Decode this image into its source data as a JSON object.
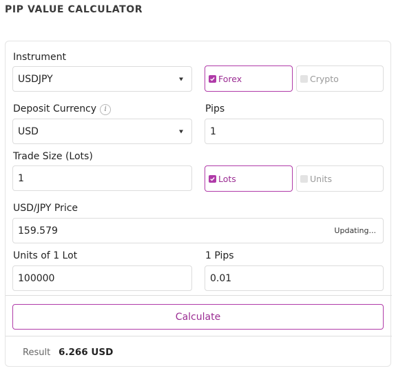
{
  "title": "PIP VALUE CALCULATOR",
  "instrument": {
    "label": "Instrument",
    "value": "USDJPY"
  },
  "market_type": {
    "forex_label": "Forex",
    "crypto_label": "Crypto",
    "selected": "Forex"
  },
  "deposit_currency": {
    "label": "Deposit Currency",
    "value": "USD",
    "info_icon": "i"
  },
  "pips": {
    "label": "Pips",
    "value": "1"
  },
  "trade_size": {
    "label": "Trade Size (Lots)",
    "value": "1"
  },
  "size_type": {
    "lots_label": "Lots",
    "units_label": "Units",
    "selected": "Lots"
  },
  "price": {
    "label": "USD/JPY Price",
    "value": "159.579",
    "status": "Updating..."
  },
  "units_per_lot": {
    "label": "Units of 1 Lot",
    "value": "100000"
  },
  "pip_size": {
    "label": "1 Pips",
    "value": "0.01"
  },
  "calculate_label": "Calculate",
  "result": {
    "label": "Result",
    "value": "6.266 USD"
  },
  "colors": {
    "accent": "#b03aa8",
    "border": "#dcdcdc"
  }
}
